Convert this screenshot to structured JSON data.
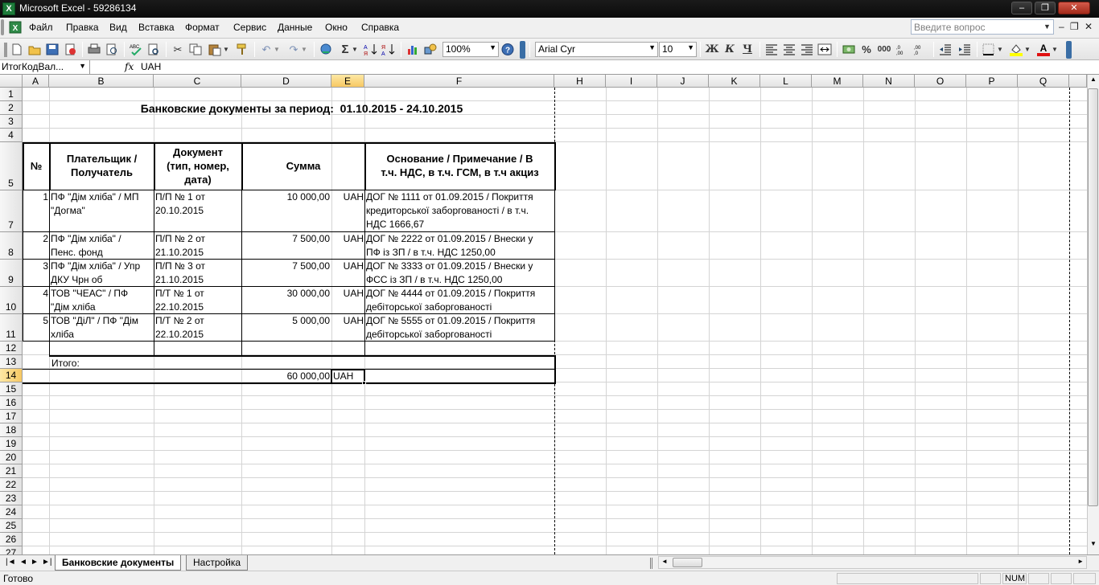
{
  "window": {
    "app_icon": "X",
    "title": "Microsoft Excel - 59286134",
    "minimize": "–",
    "restore": "❐",
    "close": "✕"
  },
  "menu": {
    "items": [
      "Файл",
      "Правка",
      "Вид",
      "Вставка",
      "Формат",
      "Сервис",
      "Данные",
      "Окно",
      "Справка"
    ],
    "ask_placeholder": "Введите вопрос",
    "mdi_minimize": "–",
    "mdi_restore": "❐",
    "mdi_close": "✕"
  },
  "toolbar": {
    "zoom": "100%",
    "font_name": "Arial Cyr",
    "font_size": "10",
    "bold": "Ж",
    "italic": "К",
    "underline": "Ч",
    "percent": "%",
    "thousands": "000",
    "sum": "Σ",
    "icons": [
      "new-icon",
      "open-icon",
      "save-icon",
      "permission-icon",
      "print-icon",
      "print-preview-icon",
      "spelling-icon",
      "research-icon",
      "cut-icon",
      "copy-icon",
      "paste-icon",
      "format-painter-icon",
      "undo-icon",
      "redo-icon",
      "hyperlink-icon",
      "autosum-icon",
      "sort-asc-icon",
      "sort-desc-icon",
      "chart-wizard-icon",
      "drawing-icon",
      "help-icon",
      "align-left-icon",
      "align-center-icon",
      "align-right-icon",
      "merge-center-icon",
      "currency-icon",
      "increase-decimal-icon",
      "decrease-decimal-icon",
      "decrease-indent-icon",
      "increase-indent-icon",
      "borders-icon",
      "fill-color-icon",
      "font-color-icon"
    ]
  },
  "formula_bar": {
    "name_box": "ИтогКодВал...",
    "fx": "fx",
    "value": "UAH"
  },
  "sheet": {
    "columns": [
      "A",
      "B",
      "C",
      "D",
      "E",
      "F",
      "H",
      "I",
      "J",
      "K",
      "L",
      "M",
      "N",
      "O",
      "P",
      "Q"
    ],
    "selected_column": "E",
    "selected_row": "14",
    "rows": [
      "1",
      "2",
      "3",
      "4",
      "5",
      "7",
      "8",
      "9",
      "10",
      "11",
      "12",
      "13",
      "14",
      "15",
      "16",
      "17",
      "18",
      "19",
      "20",
      "21",
      "22",
      "23",
      "24",
      "25",
      "26",
      "27"
    ],
    "title": "Банковские документы за период:  01.10.2015 - 24.10.2015",
    "headers": {
      "num": "№",
      "payer": "Плательщик /\nПолучатель",
      "doc": "Документ\n(тип, номер,\nдата)",
      "sum": "Сумма",
      "basis": "Основание / Примечание / В\nт.ч. НДС, в т.ч. ГСМ, в т.ч акциз"
    },
    "data_rows": [
      {
        "num": "1",
        "payer": "ПФ \"Дім хліба\" / МП\n\"Догма\"",
        "doc": "П/П № 1 от\n20.10.2015",
        "sum": "10 000,00",
        "cur": "UAH",
        "basis": "ДОГ № 1111 от 01.09.2015 / Покриття\nкредиторської заборгованості / в т.ч.\nНДС 1666,67"
      },
      {
        "num": "2",
        "payer": "ПФ \"Дім хліба\" /\nПенс. фонд",
        "doc": "П/П № 2 от\n21.10.2015",
        "sum": "7 500,00",
        "cur": "UAH",
        "basis": "ДОГ № 2222 от 01.09.2015 / Внески у\nПФ із ЗП / в т.ч. НДС 1250,00"
      },
      {
        "num": "3",
        "payer": "ПФ \"Дім хліба\" / Упр\nДКУ Чрн об",
        "doc": "П/П № 3 от\n21.10.2015",
        "sum": "7 500,00",
        "cur": "UAH",
        "basis": "ДОГ № 3333 от 01.09.2015 / Внески у\nФСС із ЗП / в т.ч. НДС 1250,00"
      },
      {
        "num": "4",
        "payer": "ТОВ \"ЧЕАС\" / ПФ\n\"Дім хліба",
        "doc": "П/Т № 1 от\n22.10.2015",
        "sum": "30 000,00",
        "cur": "UAH",
        "basis": "ДОГ № 4444 от 01.09.2015 / Покриття\nдебіторської заборгованості"
      },
      {
        "num": "5",
        "payer": "ТОВ \"ДіЛ\" / ПФ \"Дім\nхліба",
        "doc": "П/Т № 2 от\n22.10.2015",
        "sum": "5 000,00",
        "cur": "UAH",
        "basis": "ДОГ № 5555 от 01.09.2015 / Покриття\nдебіторської заборгованості"
      }
    ],
    "total_label": "Итого:",
    "total_sum": "60 000,00",
    "total_cur": "UAH"
  },
  "tabs": {
    "nav": [
      "|◄",
      "◄",
      "►",
      "►|"
    ],
    "active": "Банковские документы",
    "inactive": "Настройка"
  },
  "status": {
    "text": "Готово",
    "num": "NUM"
  }
}
